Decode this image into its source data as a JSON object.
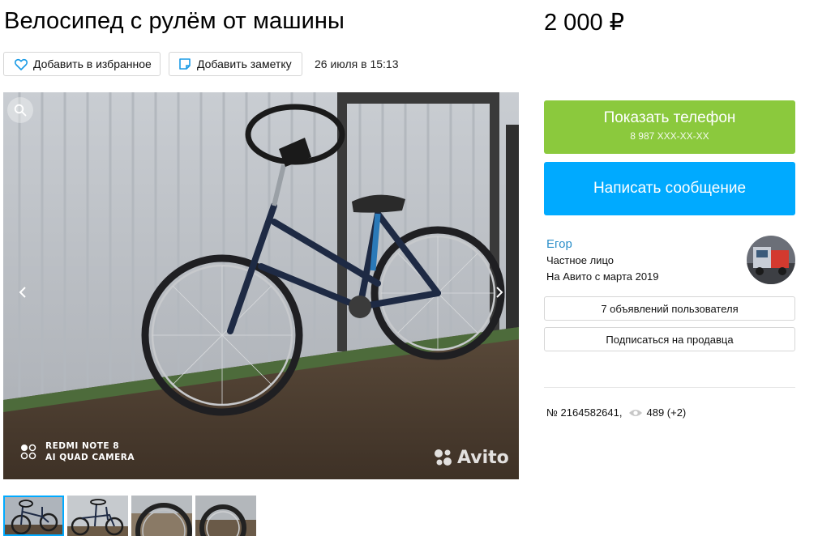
{
  "listing": {
    "title": "Велосипед с рулём от машины",
    "price": "2 000 ₽",
    "date": "26 июля в 15:13"
  },
  "actions": {
    "favorite_label": "Добавить в избранное",
    "note_label": "Добавить заметку"
  },
  "gallery": {
    "camera_line1": "REDMI NOTE 8",
    "camera_line2": "AI QUAD CAMERA",
    "watermark": "Avito",
    "thumbnail_count": 4,
    "active_thumbnail": 1
  },
  "contact": {
    "phone_label": "Показать телефон",
    "phone_masked": "8 987 XXX-XX-XX",
    "message_label": "Написать сообщение"
  },
  "seller": {
    "name": "Егор",
    "type": "Частное лицо",
    "since": "На Авито с марта 2019",
    "ads_label": "7 объявлений пользователя",
    "subscribe_label": "Подписаться на продавца"
  },
  "stats": {
    "item_number": "№ 2164582641,",
    "views": "489 (+2)"
  },
  "colors": {
    "phone_button": "#8bc93d",
    "message_button": "#00aaff",
    "seller_link": "#2c8fc9"
  }
}
